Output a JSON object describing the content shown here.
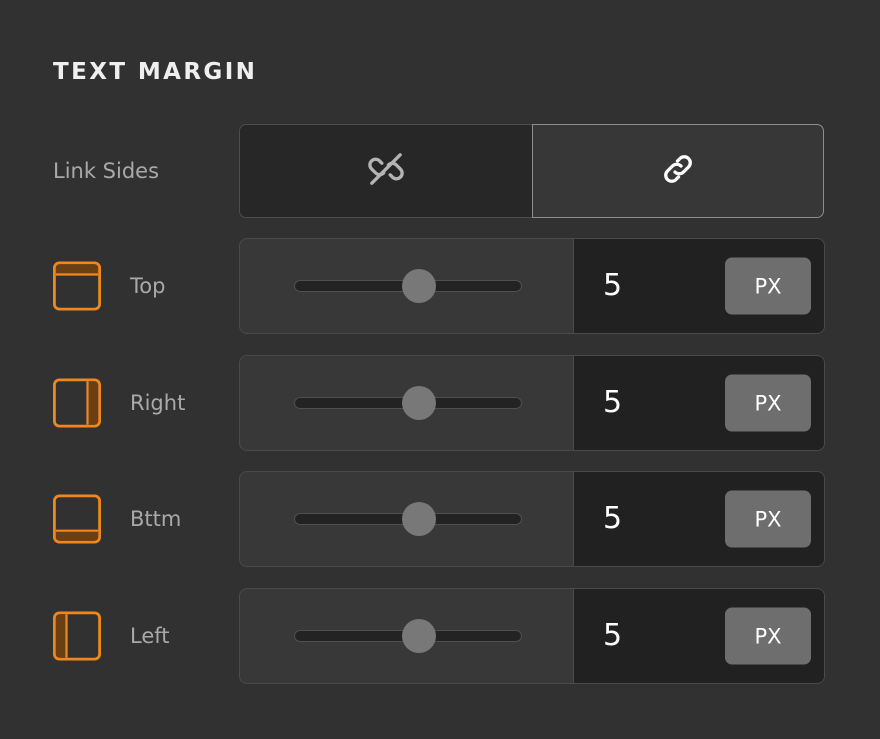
{
  "section": {
    "title": "TEXT MARGIN"
  },
  "colors": {
    "background": "#313131",
    "accent_orange": "#f0871e",
    "accent_orange_fill": "#6b3f12",
    "panel": "#383838",
    "value_panel": "#212121",
    "unit_button": "#6e6e6e",
    "label_text": "#a9a9a9",
    "title_text": "#efefef"
  },
  "link_sides": {
    "label": "Link Sides",
    "options": [
      {
        "name": "unlink",
        "icon": "broken-link-icon",
        "selected": false
      },
      {
        "name": "link",
        "icon": "link-icon",
        "selected": true
      }
    ]
  },
  "margins": [
    {
      "label": "Top",
      "icon": "margin-top-icon",
      "value": "5",
      "unit": "PX",
      "slider_percent": 55
    },
    {
      "label": "Right",
      "icon": "margin-right-icon",
      "value": "5",
      "unit": "PX",
      "slider_percent": 55
    },
    {
      "label": "Bttm",
      "icon": "margin-bottom-icon",
      "value": "5",
      "unit": "PX",
      "slider_percent": 55
    },
    {
      "label": "Left",
      "icon": "margin-left-icon",
      "value": "5",
      "unit": "PX",
      "slider_percent": 55
    }
  ]
}
